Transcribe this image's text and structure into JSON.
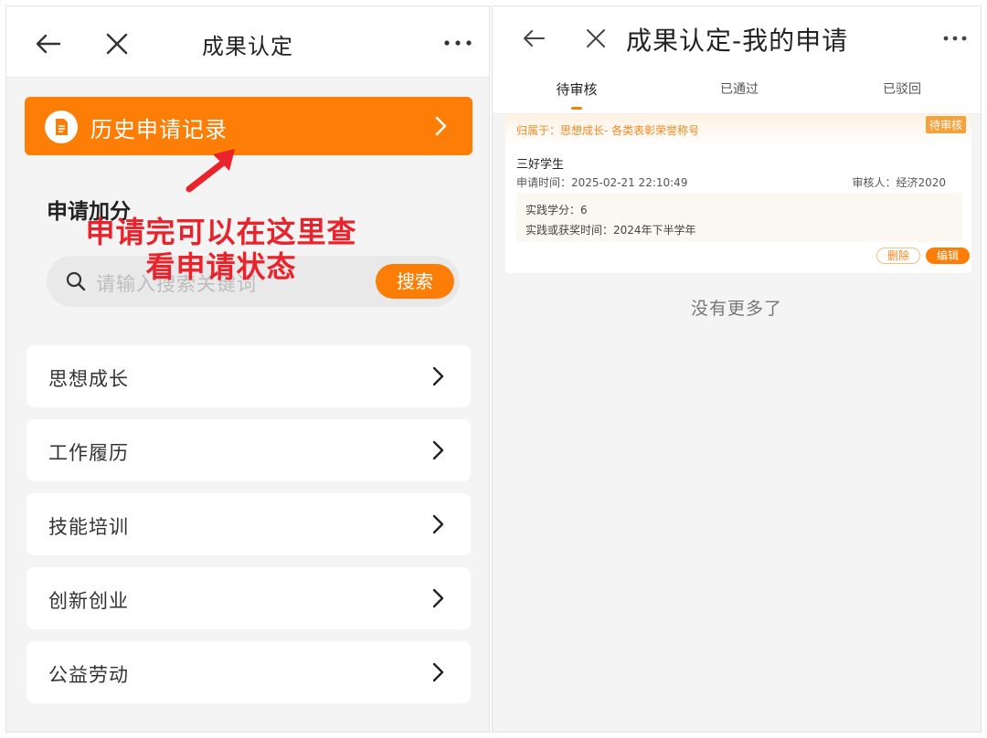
{
  "left": {
    "nav": {
      "title": "成果认定"
    },
    "history_button": {
      "label": "历史申请记录"
    },
    "section_title": "申请加分",
    "annotation": {
      "line1": "申请完可以在这里查",
      "line2": "看申请状态"
    },
    "search": {
      "placeholder": "请输入搜索关键词",
      "button_label": "搜索"
    },
    "categories": [
      {
        "label": "思想成长"
      },
      {
        "label": "工作履历"
      },
      {
        "label": "技能培训"
      },
      {
        "label": "创新创业"
      },
      {
        "label": "公益劳动"
      }
    ]
  },
  "right": {
    "nav": {
      "title": "成果认定-我的申请"
    },
    "tabs": [
      {
        "label": "待审核",
        "active": true
      },
      {
        "label": "已通过",
        "active": false
      },
      {
        "label": "已驳回",
        "active": false
      }
    ],
    "card": {
      "belong": "归属于：思想成长- 各类表彰荣誉称号",
      "status": "待审核",
      "title": "三好学生",
      "apply_time": "申请时间：2025-02-21 22:10:49",
      "reviewer": "审核人：经济2020",
      "credit": "实践学分：6",
      "award_time": "实践或获奖时间：2024年下半学年",
      "delete_label": "删除",
      "edit_label": "编辑"
    },
    "no_more": "没有更多了"
  },
  "colors": {
    "accent": "#fd7e06",
    "annotation_red": "#e8232b"
  }
}
